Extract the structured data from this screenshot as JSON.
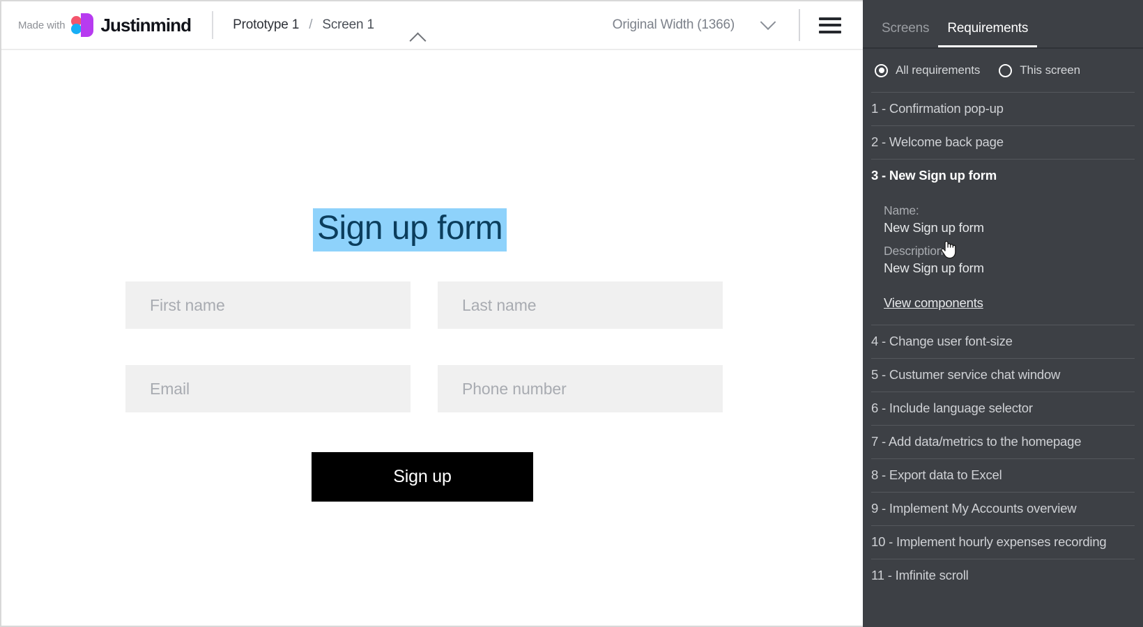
{
  "topbar": {
    "made_with": "Made with",
    "brand": "Justinmind",
    "logo_icon": "justinmind-logo-icon",
    "breadcrumb": {
      "prototype": "Prototype 1",
      "separator": "/",
      "screen": "Screen 1"
    },
    "width_selector": {
      "value": "Original Width (1366)",
      "chevron_icon": "chevron-down-icon"
    },
    "menu_icon": "hamburger-menu-icon",
    "collapse_icon": "chevron-up-icon"
  },
  "canvas": {
    "title": "Sign up form",
    "title_selected": true,
    "fields": [
      {
        "name": "first-name",
        "placeholder": "First name",
        "value": ""
      },
      {
        "name": "last-name",
        "placeholder": "Last name",
        "value": ""
      },
      {
        "name": "email",
        "placeholder": "Email",
        "value": ""
      },
      {
        "name": "phone",
        "placeholder": "Phone number",
        "value": ""
      }
    ],
    "submit_label": "Sign up"
  },
  "panel": {
    "tabs": [
      {
        "label": "Screens",
        "active": false
      },
      {
        "label": "Requirements",
        "active": true
      }
    ],
    "scope": {
      "all_label": "All requirements",
      "all_selected": true,
      "screen_label": "This screen",
      "screen_selected": false
    },
    "requirements": [
      {
        "num": "1",
        "text": "1 - Confirmation pop-up"
      },
      {
        "num": "2",
        "text": "2 - Welcome back page"
      },
      {
        "num": "3",
        "text": "3 - New Sign up form"
      },
      {
        "num": "4",
        "text": "4 - Change user font-size"
      },
      {
        "num": "5",
        "text": "5 - Custumer service chat window"
      },
      {
        "num": "6",
        "text": "6 - Include language selector"
      },
      {
        "num": "7",
        "text": "7 - Add data/metrics to the homepage"
      },
      {
        "num": "8",
        "text": "8 - Export data to Excel"
      },
      {
        "num": "9",
        "text": "9 - Implement My Accounts overview"
      },
      {
        "num": "10",
        "text": "10 - Implement hourly expenses recording"
      },
      {
        "num": "11",
        "text": "11 - Imfinite scroll"
      }
    ],
    "selected_index": 2,
    "detail": {
      "name_label": "Name:",
      "name_value": "New Sign up form",
      "description_label": "Description:",
      "description_value": "New Sign up form",
      "view_components_label": "View components",
      "cursor_icon": "pointing-hand-cursor-icon"
    }
  },
  "colors": {
    "panel_bg": "#3d4045",
    "panel_tabbar_bg": "#3d4045",
    "selection_highlight": "#8ed2fb",
    "selection_text": "#0b3d5c",
    "field_bg": "#f0f0f0",
    "button_bg": "#000000",
    "logo_red": "#f4556c",
    "logo_blue": "#18aef5",
    "logo_purple": "#b73bf0"
  }
}
